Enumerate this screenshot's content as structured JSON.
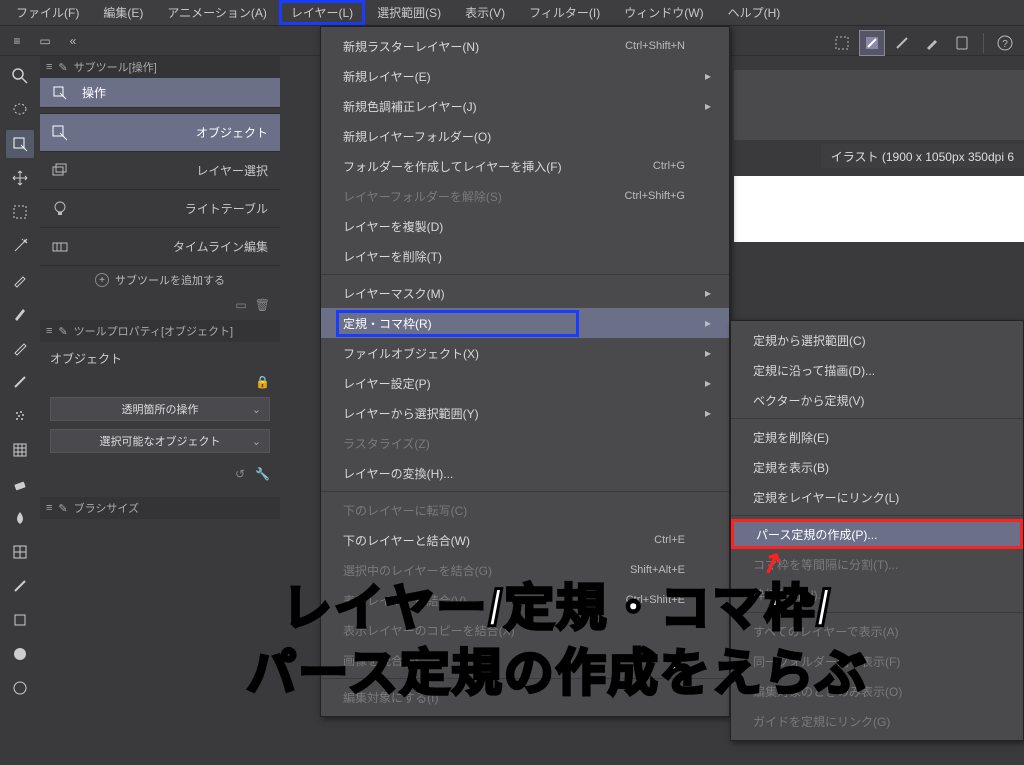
{
  "menubar": {
    "items": [
      "ファイル(F)",
      "編集(E)",
      "アニメーション(A)",
      "レイヤー(L)",
      "選択範囲(S)",
      "表示(V)",
      "フィルター(I)",
      "ウィンドウ(W)",
      "ヘルプ(H)"
    ]
  },
  "canvas_tab": "イラスト (1900 x 1050px 350dpi 6",
  "subtool_panel": {
    "title": "サブツール[操作]",
    "first": "操作",
    "items": [
      {
        "label": "オブジェクト",
        "active": true
      },
      {
        "label": "レイヤー選択",
        "active": false
      },
      {
        "label": "ライトテーブル",
        "active": false
      },
      {
        "label": "タイムライン編集",
        "active": false
      }
    ],
    "add": "サブツールを追加する"
  },
  "toolprop_panel": {
    "title": "ツールプロパティ[オブジェクト]",
    "label": "オブジェクト",
    "dd1": "透明箇所の操作",
    "dd2": "選択可能なオブジェクト"
  },
  "brush_panel": {
    "title": "ブラシサイズ"
  },
  "menu1": [
    {
      "label": "新規ラスターレイヤー(N)",
      "acc": "Ctrl+Shift+N"
    },
    {
      "label": "新規レイヤー(E)",
      "arr": true
    },
    {
      "label": "新規色調補正レイヤー(J)",
      "arr": true
    },
    {
      "label": "新規レイヤーフォルダー(O)"
    },
    {
      "label": "フォルダーを作成してレイヤーを挿入(F)",
      "acc": "Ctrl+G"
    },
    {
      "label": "レイヤーフォルダーを解除(S)",
      "acc": "Ctrl+Shift+G",
      "disabled": true
    },
    {
      "label": "レイヤーを複製(D)"
    },
    {
      "label": "レイヤーを削除(T)"
    },
    {
      "sep": true
    },
    {
      "label": "レイヤーマスク(M)",
      "arr": true
    },
    {
      "label": "定規・コマ枠(R)",
      "arr": true,
      "hover": true,
      "hlblue": true
    },
    {
      "label": "ファイルオブジェクト(X)",
      "arr": true
    },
    {
      "label": "レイヤー設定(P)",
      "arr": true
    },
    {
      "label": "レイヤーから選択範囲(Y)",
      "arr": true
    },
    {
      "label": "ラスタライズ(Z)",
      "disabled": true
    },
    {
      "label": "レイヤーの変換(H)..."
    },
    {
      "sep": true
    },
    {
      "label": "下のレイヤーに転写(C)",
      "disabled": true
    },
    {
      "label": "下のレイヤーと結合(W)",
      "acc": "Ctrl+E"
    },
    {
      "label": "選択中のレイヤーを結合(G)",
      "acc": "Shift+Alt+E",
      "disabled": true
    },
    {
      "label": "表示レイヤーを結合(V)",
      "acc": "Ctrl+Shift+E",
      "disabled": true
    },
    {
      "label": "表示レイヤーのコピーを結合(X)",
      "disabled": true
    },
    {
      "label": "画像を統合(F)",
      "disabled": true
    },
    {
      "sep": true
    },
    {
      "label": "編集対象にする(I)",
      "disabled": true
    }
  ],
  "menu2": [
    {
      "label": "定規から選択範囲(C)"
    },
    {
      "label": "定規に沿って描画(D)..."
    },
    {
      "label": "ベクターから定規(V)"
    },
    {
      "sep": true
    },
    {
      "label": "定規を削除(E)"
    },
    {
      "label": "定規を表示(B)"
    },
    {
      "label": "定規をレイヤーにリンク(L)"
    },
    {
      "sep": true
    },
    {
      "label": "パース定規の作成(P)...",
      "hover": true,
      "hlred": true
    },
    {
      "label": "コマ枠を等間隔に分割(T)...",
      "disabled": true
    },
    {
      "label": "枠線分割(U)...",
      "disabled": true
    },
    {
      "sep": true
    },
    {
      "label": "すべてのレイヤーで表示(A)",
      "disabled": true
    },
    {
      "label": "同一フォルダー内で表示(F)",
      "disabled": true
    },
    {
      "label": "編集対象のときのみ表示(O)",
      "disabled": true
    },
    {
      "label": "ガイドを定規にリンク(G)",
      "disabled": true
    }
  ],
  "annotation": "レイヤー/定規・コマ枠/\nパース定規の作成をえらぶ"
}
